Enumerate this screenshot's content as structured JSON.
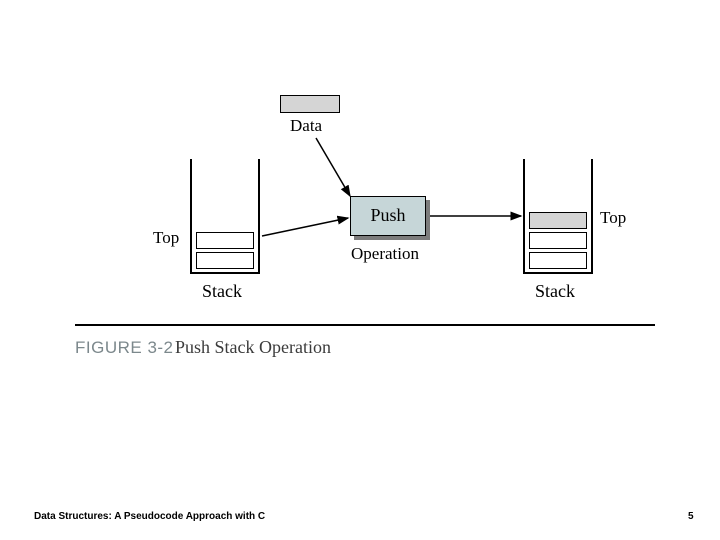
{
  "diagram": {
    "data_label": "Data",
    "push_label": "Push",
    "operation_label": "Operation",
    "left_stack": {
      "top_label": "Top",
      "caption": "Stack"
    },
    "right_stack": {
      "top_label": "Top",
      "caption": "Stack"
    }
  },
  "caption": {
    "figure_id": "FIGURE 3-2",
    "figure_title": "Push Stack Operation"
  },
  "footer": {
    "book_title": "Data Structures: A Pseudocode Approach with C",
    "page_number": "5"
  }
}
